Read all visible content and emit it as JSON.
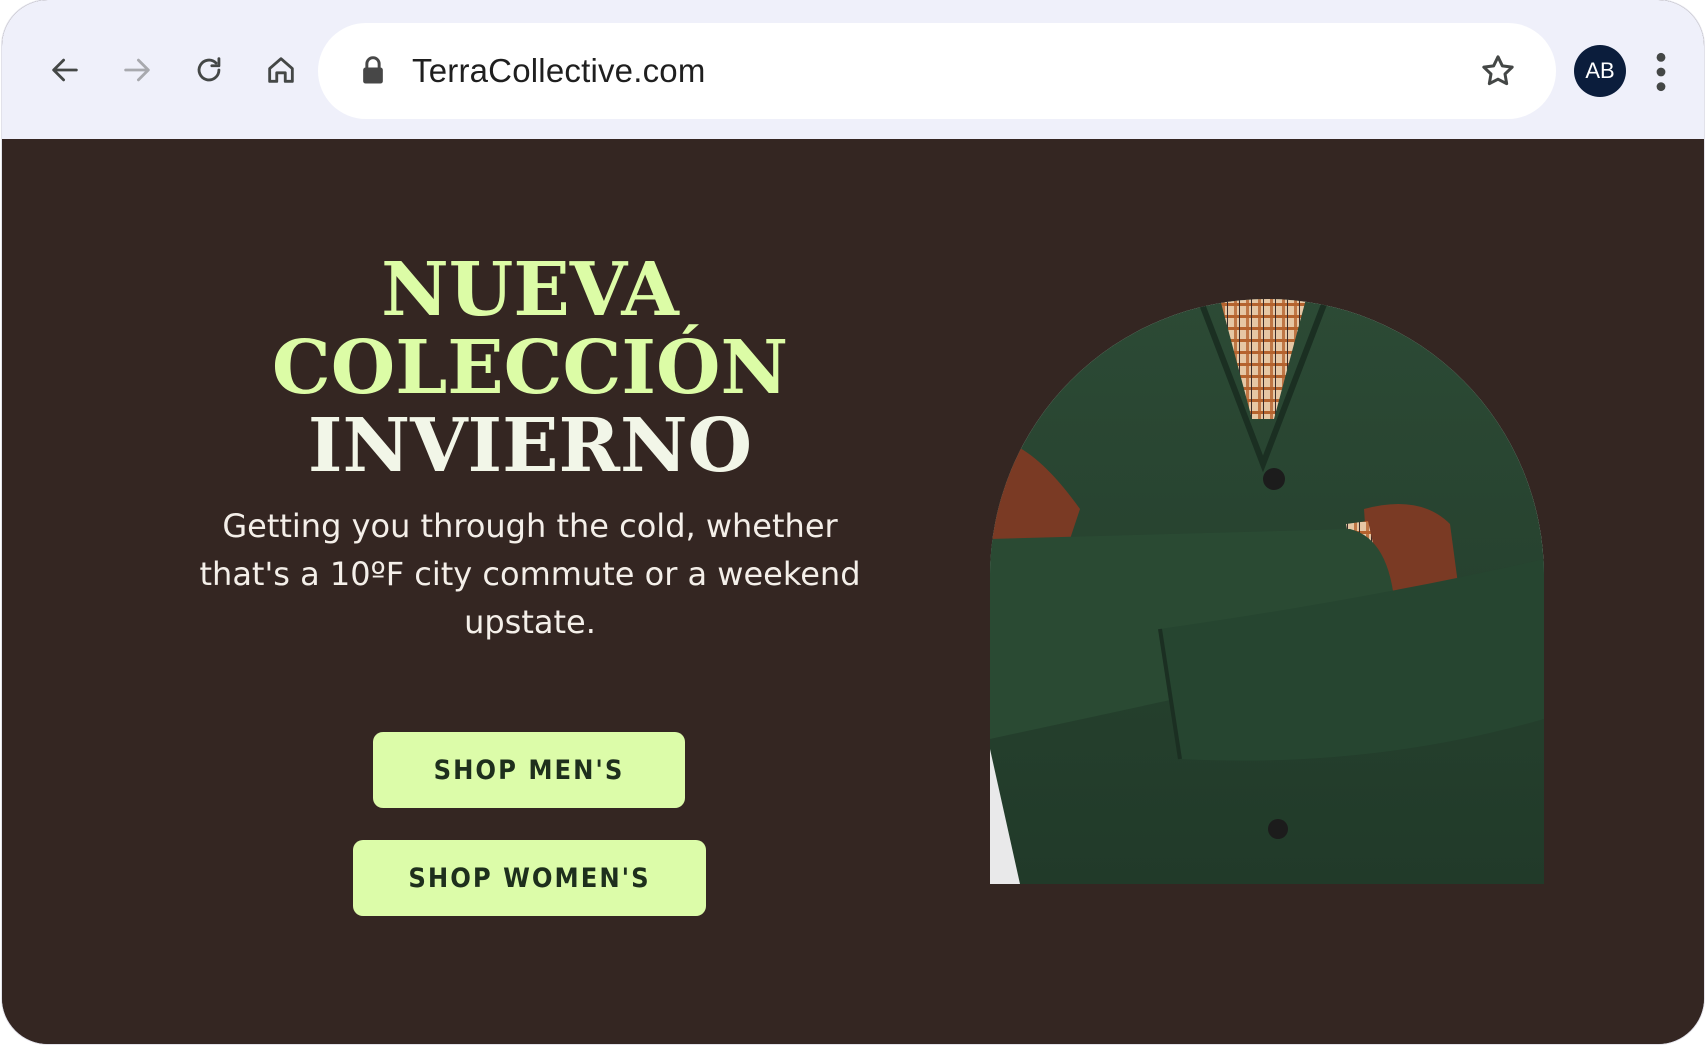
{
  "browser": {
    "url": "TerraCollective.com",
    "avatar_initials": "AB",
    "icons": [
      "back-arrow-icon",
      "forward-arrow-icon",
      "reload-icon",
      "home-icon",
      "lock-icon",
      "star-icon",
      "kebab-menu-icon"
    ]
  },
  "hero": {
    "headline": {
      "line1": "NUEVA",
      "line2": "COLECCIÓN",
      "line3": "INVIERNO"
    },
    "subtext": "Getting you through the cold, whether that's a 10ºF city commute or a weekend upstate.",
    "buttons": {
      "shop_mens": "SHOP MEN'S",
      "shop_womens": "SHOP WOMEN'S"
    }
  },
  "colors": {
    "background": "#342622",
    "headline_accent": "#dcfca6",
    "button_bg": "#dcfca9",
    "toolbar": "#eff0fa"
  }
}
